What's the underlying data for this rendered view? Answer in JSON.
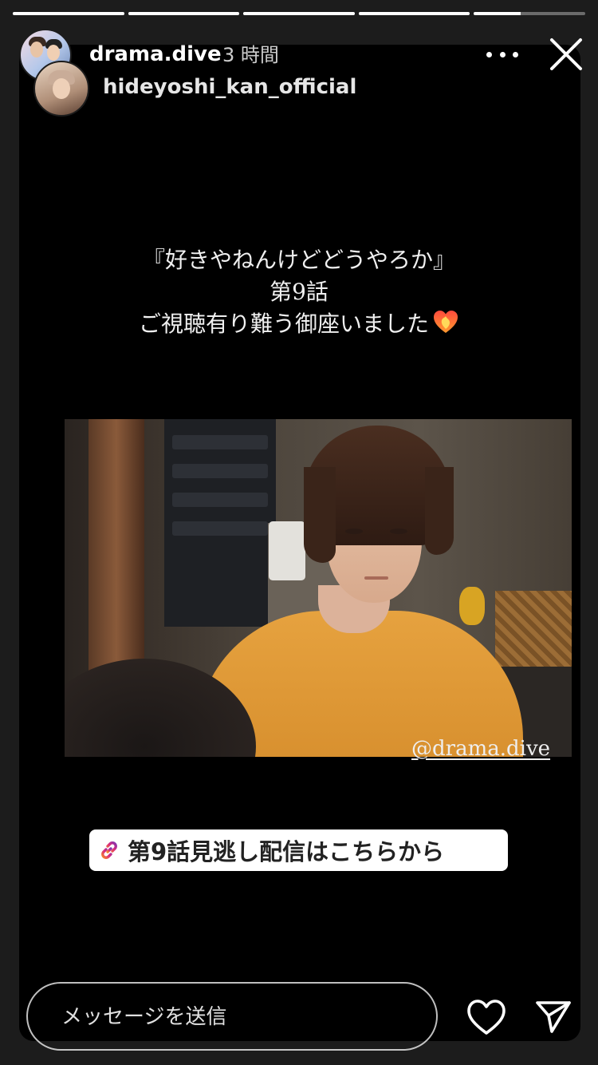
{
  "progress": {
    "segments": [
      1,
      1,
      1,
      1,
      0.42
    ]
  },
  "header": {
    "username": "drama.dive",
    "time": "3 時間",
    "reshared_from": "hideyoshi_kan_official",
    "more_icon": "more-horizontal-icon",
    "close_icon": "close-icon"
  },
  "story": {
    "caption": {
      "line1": "『好きやねんけどどうやろか』",
      "line2": "第9話",
      "line3": "ご視聴有り難う御座いました"
    },
    "photo_description_icon": "heart-fire-emoji",
    "watermark": "@drama.dive",
    "link_sticker": {
      "icon": "link-icon",
      "label": "第9話見逃し配信はこちらから"
    }
  },
  "footer": {
    "message_placeholder": "メッセージを送信",
    "like_icon": "heart-icon",
    "send_icon": "send-icon"
  },
  "colors": {
    "background": "#1c1c1c",
    "story_bg": "#000000",
    "shirt": "#e6a23f",
    "link_gradient_start": "#f58529",
    "link_gradient_end": "#8134af"
  }
}
